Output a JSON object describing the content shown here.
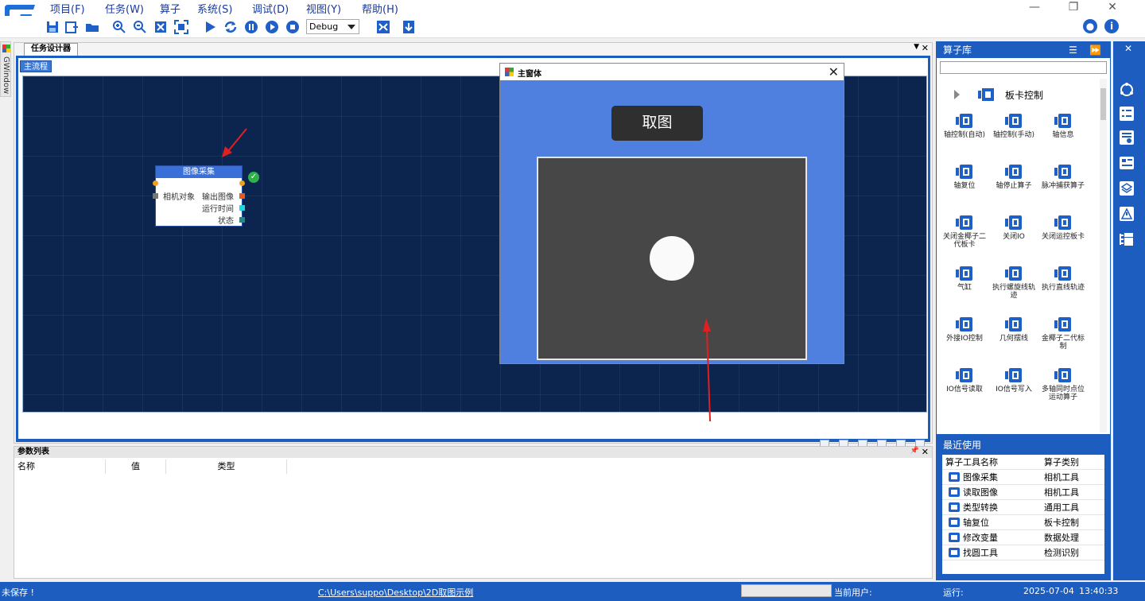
{
  "menu": {
    "items": [
      "项目(F)",
      "任务(W)",
      "算子",
      "系统(S)",
      "调试(D)",
      "视图(Y)",
      "帮助(H)"
    ]
  },
  "toolbar": {
    "mode_select": "Debug"
  },
  "left_strip": {
    "label": "GWindow"
  },
  "designer": {
    "tab_label": "任务设计器",
    "flow_tab": "主流程",
    "node": {
      "title": "图像采集",
      "input_label": "相机对象",
      "outputs": [
        "输出图像",
        "运行时间",
        "状态"
      ]
    }
  },
  "popup": {
    "title": "主窗体",
    "grab_button": "取图",
    "close": "✕"
  },
  "params": {
    "title": "参数列表",
    "columns": [
      "名称",
      "值",
      "类型"
    ]
  },
  "library": {
    "title": "算子库",
    "category": "板卡控制",
    "operators": [
      {
        "label": "轴控制(自动)",
        "icon": "axis-auto-icon"
      },
      {
        "label": "轴控制(手动)",
        "icon": "axis-manual-icon"
      },
      {
        "label": "轴信息",
        "icon": "axis-info-icon"
      },
      {
        "label": "轴复位",
        "icon": "axis-reset-icon"
      },
      {
        "label": "轴停止算子",
        "icon": "axis-stop-icon"
      },
      {
        "label": "脉冲捕获算子",
        "icon": "pulse-capture-icon"
      },
      {
        "label": "关闭金椰子二代板卡",
        "icon": "close-card-icon"
      },
      {
        "label": "关闭IO",
        "icon": "close-io-icon"
      },
      {
        "label": "关闭运控板卡",
        "icon": "close-motion-icon"
      },
      {
        "label": "气缸",
        "icon": "cylinder-icon"
      },
      {
        "label": "执行螺旋线轨迹",
        "icon": "spiral-icon"
      },
      {
        "label": "执行直线轨迹",
        "icon": "line-track-icon"
      },
      {
        "label": "外接IO控制",
        "icon": "external-io-icon"
      },
      {
        "label": "几何摆线",
        "icon": "cycloid-icon"
      },
      {
        "label": "金椰子二代标制",
        "icon": "var-icon"
      },
      {
        "label": "IO信号读取",
        "icon": "io-read-icon"
      },
      {
        "label": "IO信号写入",
        "icon": "io-write-icon"
      },
      {
        "label": "多轴同时点位运动算子",
        "icon": "multi-axis-icon"
      }
    ],
    "recent": {
      "title": "最近使用",
      "header": {
        "name": "算子工具名称",
        "type": "算子类别"
      },
      "rows": [
        {
          "name": "图像采集",
          "type": "相机工具",
          "icon": "camera-icon"
        },
        {
          "name": "读取图像",
          "type": "相机工具",
          "icon": "image-icon"
        },
        {
          "name": "类型转换",
          "type": "通用工具",
          "icon": "convert-icon"
        },
        {
          "name": "轴复位",
          "type": "板卡控制",
          "icon": "axis-reset-icon"
        },
        {
          "name": "修改变量",
          "type": "数据处理",
          "icon": "var-icon"
        },
        {
          "name": "找圆工具",
          "type": "检测识别",
          "icon": "find-circle-icon"
        }
      ]
    }
  },
  "status": {
    "save_state": "未保存 !",
    "path": "C:\\Users\\suppo\\Desktop\\2D取图示例",
    "current_user_label": "当前用户:",
    "running_label": "运行:",
    "date": "2025-07-04",
    "time": "13:40:33"
  },
  "colors": {
    "accent": "#1d5dbf",
    "canvas": "#0b254f",
    "popup_bg": "#4f7fdf",
    "arrow": "#e02020"
  }
}
